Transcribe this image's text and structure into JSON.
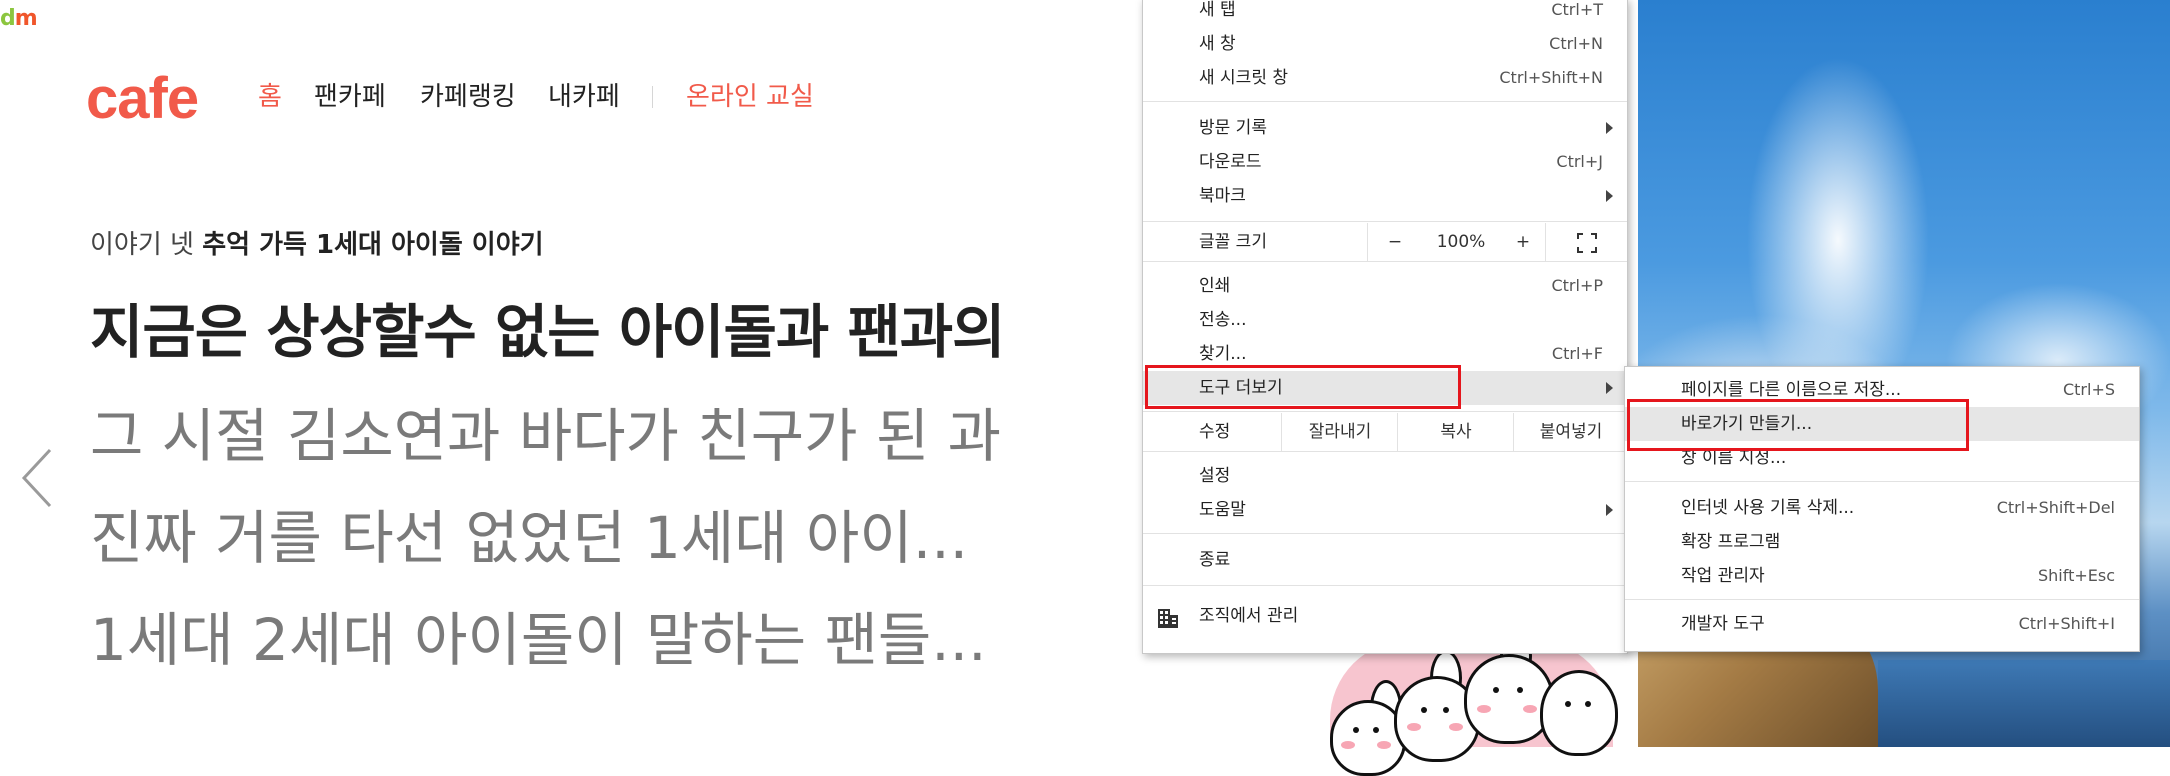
{
  "page": {
    "daum_logo_d": "d",
    "daum_logo_rest": "m",
    "cafe_logo": "cafe",
    "nav": [
      "홈",
      "팬카페",
      "카페랭킹",
      "내카페"
    ],
    "nav_online": "온라인 교실",
    "story_prefix": "이야기 넷",
    "story_title": "추억 가득 1세대 아이돌 이야기",
    "headline": "지금은 상상할수 없는 아이돌과 팬과의",
    "sub_items": [
      "그 시절 김소연과 바다가 친구가 된 과",
      "진짜 거를 타선 없었던 1세대 아이...",
      "1세대 2세대 아이돌이 말하는 팬들..."
    ]
  },
  "main_menu": {
    "new_tab": {
      "label": "새 탭",
      "shortcut": "Ctrl+T"
    },
    "new_window": {
      "label": "새 창",
      "shortcut": "Ctrl+N"
    },
    "incognito": {
      "label": "새 시크릿 창",
      "shortcut": "Ctrl+Shift+N"
    },
    "history": {
      "label": "방문 기록"
    },
    "downloads": {
      "label": "다운로드",
      "shortcut": "Ctrl+J"
    },
    "bookmarks": {
      "label": "북마크"
    },
    "zoom": {
      "label": "글꼴 크기",
      "minus": "−",
      "value": "100%",
      "plus": "+"
    },
    "print": {
      "label": "인쇄",
      "shortcut": "Ctrl+P"
    },
    "cast": {
      "label": "전송..."
    },
    "find": {
      "label": "찾기...",
      "shortcut": "Ctrl+F"
    },
    "more_tools": {
      "label": "도구 더보기"
    },
    "edit": {
      "label": "수정",
      "cut": "잘라내기",
      "copy": "복사",
      "paste": "붙여넣기"
    },
    "settings": {
      "label": "설정"
    },
    "help": {
      "label": "도움말"
    },
    "exit": {
      "label": "종료"
    },
    "managed": {
      "label": "조직에서 관리"
    }
  },
  "sub_menu": {
    "save_as": {
      "label": "페이지를 다른 이름으로 저장...",
      "shortcut": "Ctrl+S"
    },
    "create_shortcut": {
      "label": "바로가기 만들기..."
    },
    "name_window": {
      "label": "창 이름 지정..."
    },
    "clear_data": {
      "label": "인터넷 사용 기록 삭제...",
      "shortcut": "Ctrl+Shift+Del"
    },
    "extensions": {
      "label": "확장 프로그램"
    },
    "task_manager": {
      "label": "작업 관리자",
      "shortcut": "Shift+Esc"
    },
    "dev_tools": {
      "label": "개발자 도구",
      "shortcut": "Ctrl+Shift+I"
    }
  },
  "colors": {
    "brand": "#f15a4a",
    "highlight_outline": "#e5161d",
    "menu_hover": "#e6e6e6"
  }
}
